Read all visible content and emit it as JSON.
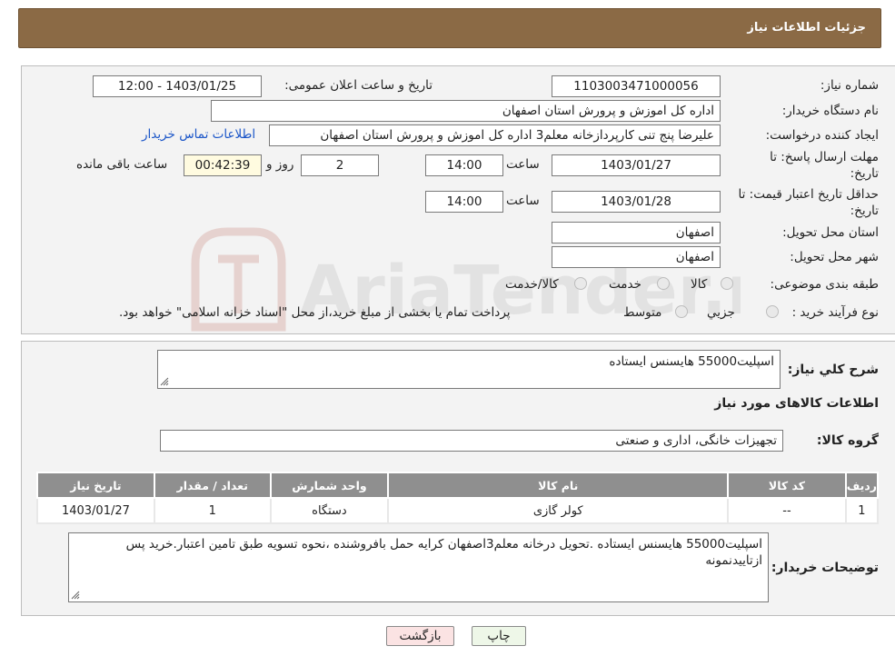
{
  "header": {
    "title": "جزئیات اطلاعات نیاز"
  },
  "form": {
    "need_number_label": "شماره نیاز:",
    "need_number": "1103003471000056",
    "announce_label": "تاریخ و ساعت اعلان عمومی:",
    "announce_value": "1403/01/25 - 12:00",
    "buyer_org_label": "نام دستگاه خریدار:",
    "buyer_org": "اداره کل اموزش و پرورش استان اصفهان",
    "creator_label": "ایجاد کننده درخواست:",
    "creator": "علیرضا پنج تنی کارپردازخانه معلم3 اداره کل اموزش و پرورش استان اصفهان",
    "contact_link": "اطلاعات تماس خریدار",
    "reply_deadline_label_1": "مهلت ارسال پاسخ: تا",
    "reply_deadline_label_2": "تاریخ:",
    "reply_date": "1403/01/27",
    "time_label": "ساعت",
    "reply_time": "14:00",
    "days": "2",
    "days_label": "روز و",
    "remaining": "00:42:39",
    "remaining_label": "ساعت باقی مانده",
    "price_validity_label_1": "حداقل تاریخ اعتبار قیمت: تا",
    "price_validity_label_2": "تاریخ:",
    "price_date": "1403/01/28",
    "price_time": "14:00",
    "province_label": "استان محل تحویل:",
    "province": "اصفهان",
    "city_label": "شهر محل تحویل:",
    "city": "اصفهان",
    "category_label": "طبقه بندی موضوعی:",
    "category_options": [
      "کالا",
      "خدمت",
      "کالا/خدمت"
    ],
    "process_label": "نوع فرآیند خرید :",
    "process_options": [
      "جزیي",
      "متوسط"
    ],
    "process_note": "پرداخت تمام یا بخشی از مبلغ خرید،از محل \"اسناد خزانه اسلامی\" خواهد بود."
  },
  "details": {
    "summary_label": "شرح کلي نياز:",
    "summary": "اسپلیت55000 هایسنس ایستاده",
    "goods_info_title": "اطلاعات کالاهای مورد نياز",
    "goods_group_label": "گروه کالا:",
    "goods_group": "تجهیزات خانگی، اداری و صنعتی",
    "table": {
      "headers": [
        "ردیف",
        "کد کالا",
        "نام کالا",
        "واحد شمارش",
        "تعداد / مقدار",
        "تاریخ نیاز"
      ],
      "rows": [
        [
          "1",
          "--",
          "کولر گازی",
          "دستگاه",
          "1",
          "1403/01/27"
        ]
      ]
    },
    "buyer_notes_label": "توضیحات خریدار:",
    "buyer_notes": "اسپلیت55000 هایسنس ایستاده .تحویل درخانه معلم3اصفهان کرایه حمل بافروشنده ،نحوه تسویه طبق تامین اعتبار.خرید پس ازتاییدنمونه"
  },
  "buttons": {
    "print": "چاپ",
    "back": "بازگشت"
  },
  "watermark": {
    "text": "AriaTender.neT"
  },
  "colors": {
    "header": "#8b6a45",
    "table_header": "#8f8f8f",
    "link": "#1a55c8",
    "back_button": "#fbe3e3"
  }
}
